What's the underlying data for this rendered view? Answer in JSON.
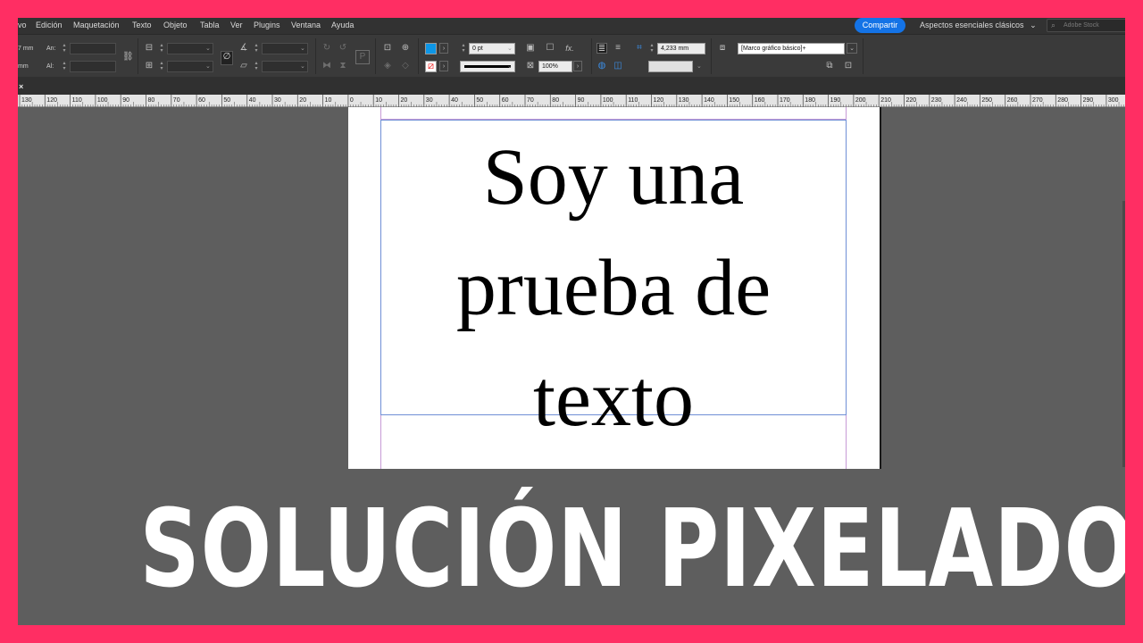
{
  "menubar": {
    "items": [
      "vo",
      "Edición",
      "Maquetación",
      "Texto",
      "Objeto",
      "Tabla",
      "Ver",
      "Plugins",
      "Ventana",
      "Ayuda"
    ],
    "share_label": "Compartir",
    "workspace_label": "Aspectos esenciales clásicos",
    "search_placeholder": "Adobe Stock"
  },
  "controlbar": {
    "x_unit": "7 mm",
    "y_unit": "mm",
    "width_label": "An:",
    "height_label": "Al:",
    "stroke_weight": "0 pt",
    "opacity": "100%",
    "column_gutter": "4,233 mm",
    "object_style": "[Marco gráfico básico]+",
    "fill_color": "#0d96e6",
    "stroke_color": "#111111"
  },
  "ruler": {
    "labels": [
      "130",
      "120",
      "110",
      "100",
      "90",
      "80",
      "70",
      "60",
      "50",
      "40",
      "30",
      "20",
      "10",
      "0",
      "10",
      "20",
      "30",
      "40",
      "50",
      "60",
      "70",
      "80",
      "90",
      "100",
      "110",
      "120",
      "130",
      "140",
      "150",
      "160",
      "170",
      "180",
      "190",
      "200",
      "210",
      "220",
      "230",
      "240",
      "250",
      "260",
      "270",
      "280",
      "290",
      "300"
    ]
  },
  "document": {
    "text_line_1": "Soy una",
    "text_line_2": "prueba de",
    "text_line_3": "texto"
  },
  "overlay": {
    "title": "SOLUCIÓN PIXELADO"
  },
  "colors": {
    "border": "#ff2e63",
    "accent": "#1473e6"
  }
}
